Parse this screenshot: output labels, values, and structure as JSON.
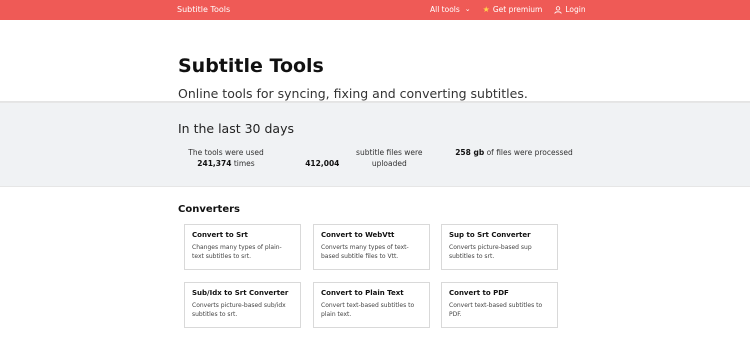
{
  "nav": {
    "brand": "Subtitle Tools",
    "all_tools": "All tools",
    "premium": "Get premium",
    "login": "Login"
  },
  "hero": {
    "title": "Subtitle Tools",
    "subtitle": "Online tools for syncing, fixing and converting subtitles."
  },
  "stats": {
    "heading": "In the last 30 days",
    "items": [
      {
        "pre": "The tools were used",
        "value": "241,374",
        "post": "times"
      },
      {
        "pre": "",
        "value": "412,004",
        "post": "subtitle files were uploaded"
      },
      {
        "pre": "",
        "value": "258 gb",
        "post": "of files were processed"
      }
    ]
  },
  "converters": {
    "heading": "Converters",
    "cards": [
      {
        "title": "Convert to Srt",
        "desc": "Changes many types of plain-text subtitles to srt."
      },
      {
        "title": "Convert to WebVtt",
        "desc": "Converts many types of text-based subtitle files to Vtt."
      },
      {
        "title": "Sup to Srt Converter",
        "desc": "Converts picture-based sup subtitles to srt."
      },
      {
        "title": "Sub/Idx to Srt Converter",
        "desc": "Converts picture-based sub/idx subtitles to srt."
      },
      {
        "title": "Convert to Plain Text",
        "desc": "Convert text-based subtitles to plain text."
      },
      {
        "title": "Convert to PDF",
        "desc": "Convert text-based subtitles to PDF."
      }
    ]
  },
  "colors": {
    "navbar": "#ef5a56",
    "stats_bg": "#f0f2f4",
    "star": "#ffd54a"
  }
}
